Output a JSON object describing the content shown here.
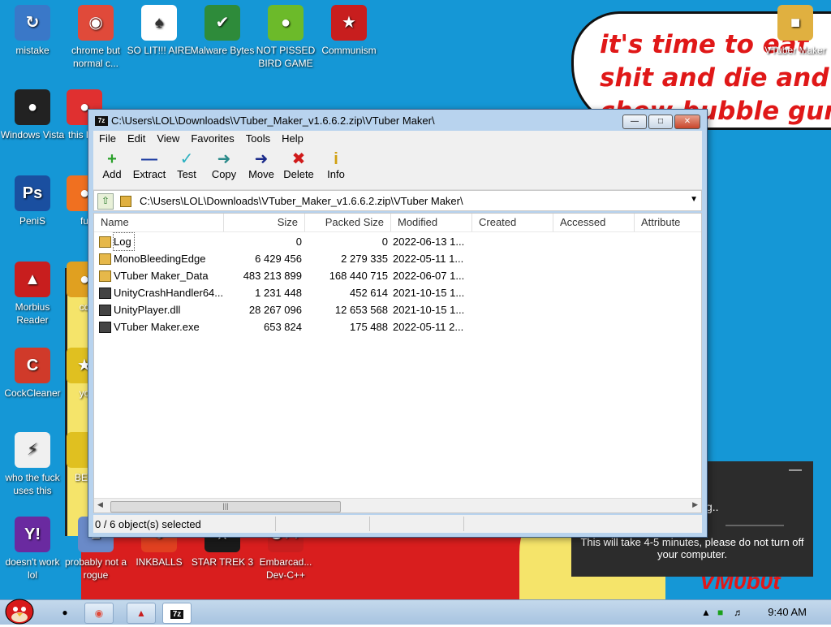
{
  "desktop": {
    "bubble_text": "it's time to eat shit and die and chew bubble gum",
    "corner_logo": "VM0b0t",
    "icons": [
      {
        "label": "mistake",
        "glyph": "↻",
        "color": "#3a78c8"
      },
      {
        "label": "chrome but normal c...",
        "glyph": "◉",
        "color": "#e04a3a"
      },
      {
        "label": "SO LIT!!! AIRE",
        "glyph": "♠",
        "color": "#ffffff"
      },
      {
        "label": "Malware Bytes",
        "glyph": "✔",
        "color": "#2e8b3a"
      },
      {
        "label": "NOT PISSED BIRD GAME",
        "glyph": "●",
        "color": "#6cba2a"
      },
      {
        "label": "Communism",
        "glyph": "★",
        "color": "#c81e1e"
      },
      {
        "label": "VTuber Maker",
        "glyph": "■",
        "color": "#e0b040"
      },
      {
        "label": "Windows Vista",
        "glyph": "●",
        "color": "#222222"
      },
      {
        "label": "this like",
        "glyph": "●",
        "color": "#e03030"
      },
      {
        "label": "PeniS",
        "glyph": "Ps",
        "color": "#1a4fa0"
      },
      {
        "label": "fu",
        "glyph": "●",
        "color": "#f07020"
      },
      {
        "label": "Morbius Reader",
        "glyph": "▲",
        "color": "#c81e1e"
      },
      {
        "label": "cd",
        "glyph": "●",
        "color": "#e0a020"
      },
      {
        "label": "CockCleaner",
        "glyph": "C",
        "color": "#d03a2a"
      },
      {
        "label": "yo",
        "glyph": "★",
        "color": "#e0c020"
      },
      {
        "label": "who the fuck uses this",
        "glyph": "⚡",
        "color": "#f0f0f0"
      },
      {
        "label": "BEE",
        "glyph": "",
        "color": "#e0c020"
      },
      {
        "label": "doesn't work lol",
        "glyph": "Y!",
        "color": "#6a2aa0"
      },
      {
        "label": "probably not a rogue",
        "glyph": "■",
        "color": "#6a8ac8"
      },
      {
        "label": "INKBALLS",
        "glyph": "●",
        "color": "#e04020"
      },
      {
        "label": "STAR TREK 3",
        "glyph": "★",
        "color": "#1a1a1a"
      },
      {
        "label": "Embarcad... Dev-C++",
        "glyph": "C++",
        "color": "#c81e1e"
      }
    ]
  },
  "window": {
    "title": "C:\\Users\\LOL\\Downloads\\VTuber_Maker_v1.6.6.2.zip\\VTuber Maker\\",
    "app_icon": "7z",
    "menu": [
      "File",
      "Edit",
      "View",
      "Favorites",
      "Tools",
      "Help"
    ],
    "toolbar": [
      {
        "label": "Add",
        "glyph": "+",
        "color": "#2aa02a"
      },
      {
        "label": "Extract",
        "glyph": "—",
        "color": "#1a3aa0"
      },
      {
        "label": "Test",
        "glyph": "✓",
        "color": "#2ab0c0"
      },
      {
        "label": "Copy",
        "glyph": "➜",
        "color": "#2a8a8a"
      },
      {
        "label": "Move",
        "glyph": "➜",
        "color": "#1a2a8a"
      },
      {
        "label": "Delete",
        "glyph": "✖",
        "color": "#d01a1a"
      },
      {
        "label": "Info",
        "glyph": "i",
        "color": "#d0a010"
      }
    ],
    "address": "C:\\Users\\LOL\\Downloads\\VTuber_Maker_v1.6.6.2.zip\\VTuber Maker\\",
    "columns": [
      "Name",
      "Size",
      "Packed Size",
      "Modified",
      "Created",
      "Accessed",
      "Attribute"
    ],
    "rows": [
      {
        "name": "Log",
        "type": "folder",
        "size": "0",
        "packed": "0",
        "modified": "2022-06-13 1..."
      },
      {
        "name": "MonoBleedingEdge",
        "type": "folder",
        "size": "6 429 456",
        "packed": "2 279 335",
        "modified": "2022-05-11 1..."
      },
      {
        "name": "VTuber Maker_Data",
        "type": "folder",
        "size": "483 213 899",
        "packed": "168 440 715",
        "modified": "2022-06-07 1..."
      },
      {
        "name": "UnityCrashHandler64....",
        "type": "file",
        "size": "1 231 448",
        "packed": "452 614",
        "modified": "2021-10-15 1..."
      },
      {
        "name": "UnityPlayer.dll",
        "type": "file",
        "size": "28 267 096",
        "packed": "12 653 568",
        "modified": "2021-10-15 1..."
      },
      {
        "name": "VTuber Maker.exe",
        "type": "file",
        "size": "653 824",
        "packed": "175 488",
        "modified": "2022-05-11 2..."
      }
    ],
    "status": "0 / 6 object(s) selected"
  },
  "notification": {
    "partial": "g..",
    "message": "This will take 4-5 minutes, please do not turn off your computer."
  },
  "taskbar": {
    "items": [
      "chrome",
      "winrar",
      "7z"
    ],
    "clock": "9:40 AM"
  }
}
